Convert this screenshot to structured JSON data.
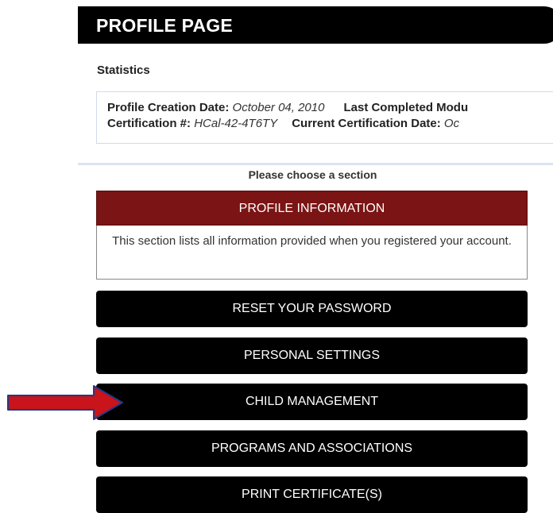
{
  "header": {
    "title": "PROFILE PAGE"
  },
  "stats": {
    "heading": "Statistics",
    "creation_label": "Profile Creation Date:",
    "creation_value": "October 04, 2010",
    "last_module_label": "Last Completed Modu",
    "cert_label": "Certification #:",
    "cert_value": "HCal-42-4T6TY",
    "current_cert_label": "Current Certification Date:",
    "current_cert_value": "Oc"
  },
  "sections": {
    "prompt": "Please choose a section",
    "active": {
      "label": "PROFILE INFORMATION",
      "description": "This section lists all information provided when you registered your account."
    },
    "buttons": [
      {
        "label": "RESET YOUR PASSWORD"
      },
      {
        "label": "PERSONAL SETTINGS"
      },
      {
        "label": "CHILD MANAGEMENT"
      },
      {
        "label": "PROGRAMS AND ASSOCIATIONS"
      },
      {
        "label": "PRINT CERTIFICATE(S)"
      }
    ]
  },
  "colors": {
    "header_bg": "#000000",
    "active_section_bg": "#7b1414",
    "button_bg": "#000000",
    "arrow_fill": "#c8141a",
    "arrow_outline": "#1f3a8a"
  },
  "annotation": {
    "arrow_icon": "arrow-right-icon"
  }
}
